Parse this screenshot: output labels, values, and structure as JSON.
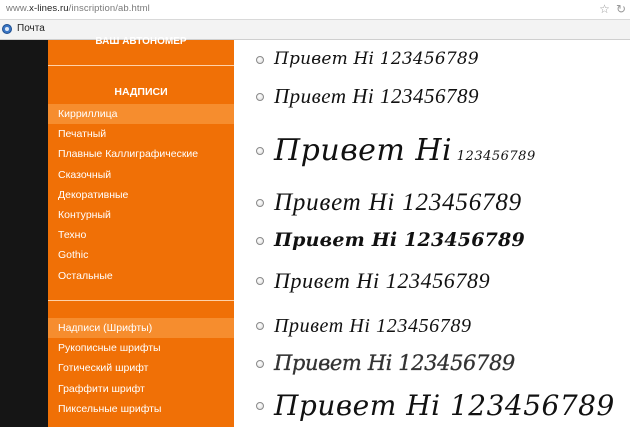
{
  "browser": {
    "url_prefix": "www.",
    "url_host": "x-lines.ru",
    "url_path": "/inscription/ab.html",
    "star_icon": "star-icon",
    "refresh_icon": "refresh-icon",
    "bookmark_label": "Почта",
    "bookmark_icon": "mail-icon"
  },
  "sidebar": {
    "top_title": "ВАШ АВТОНОМЕР",
    "section_title": "НАДПИСИ",
    "menu1": [
      "Кирриллица",
      "Печатный",
      "Плавные Каллиграфические",
      "Сказочный",
      "Декоративные",
      "Контурный",
      "Техно",
      "Gothic",
      "Остальные"
    ],
    "menu2": [
      "Надписи (Шрифты)",
      "Рукописные шрифты",
      "Готический шрифт",
      "Граффити шрифт",
      "Пиксельные шрифты"
    ],
    "active_item_1": "Кирриллица",
    "active_item_2": "Надписи (Шрифты)",
    "colors": {
      "sidebar_bg": "#f07006",
      "active_bg": "#f68d2e",
      "left_strip": "#151515"
    }
  },
  "samples": {
    "text": "Привет Hi 123456789",
    "items": [
      "Привет Hi 123456789",
      "Привет Hi 123456789",
      "Привет Hi 123456789",
      "Привет Hi 123456789",
      "Привет Hi 123456789",
      "Привет Hi 123456789",
      "Привет Hi 123456789",
      "Привет Hi 123456789",
      "Привет Hi 123456789"
    ]
  }
}
